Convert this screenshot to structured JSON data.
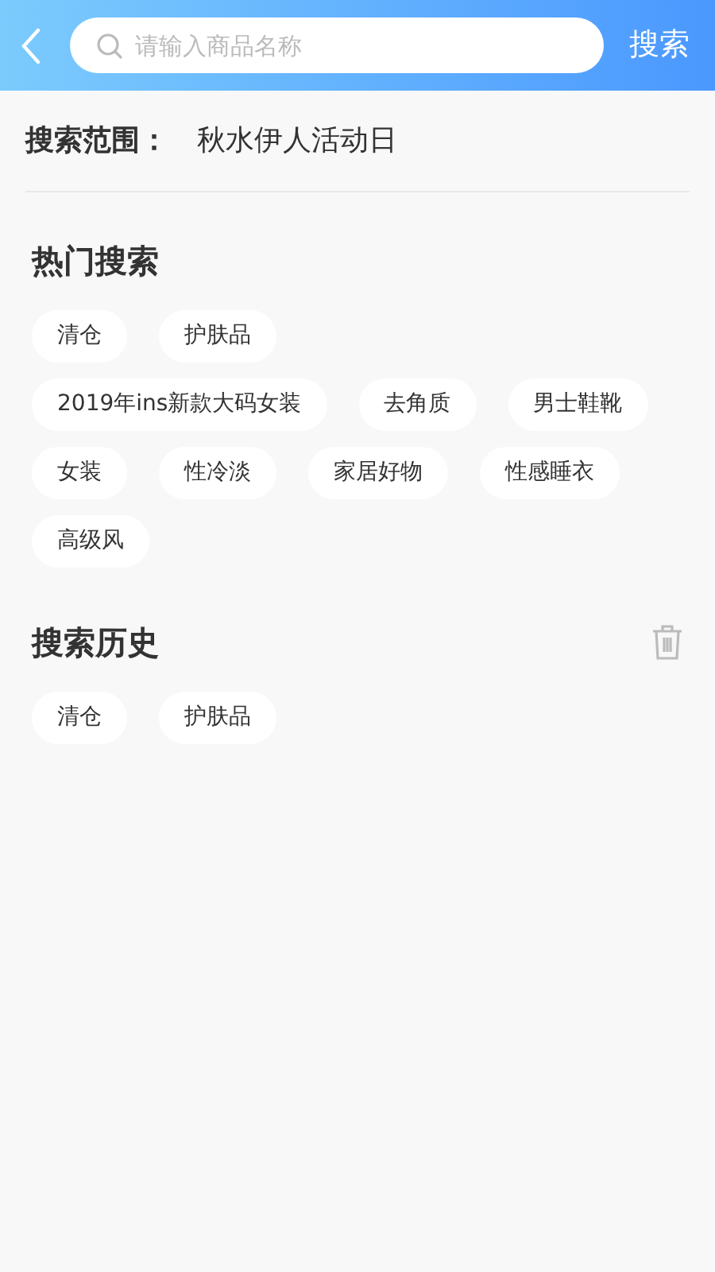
{
  "header": {
    "search": {
      "placeholder": "请输入商品名称"
    },
    "search_button": "搜索"
  },
  "scope": {
    "label": "搜索范围：",
    "value": "秋水伊人活动日"
  },
  "hot_search": {
    "title": "热门搜索",
    "tag_rows": [
      [
        "清仓",
        "护肤品"
      ],
      [
        "2019年ins新款大码女装",
        "去角质",
        "男士鞋靴"
      ],
      [
        "女装",
        "性冷淡",
        "家居好物",
        "性感睡衣"
      ],
      [
        "高级风"
      ]
    ]
  },
  "history": {
    "title": "搜索历史",
    "tag_rows": [
      [
        "清仓",
        "护肤品"
      ]
    ]
  }
}
